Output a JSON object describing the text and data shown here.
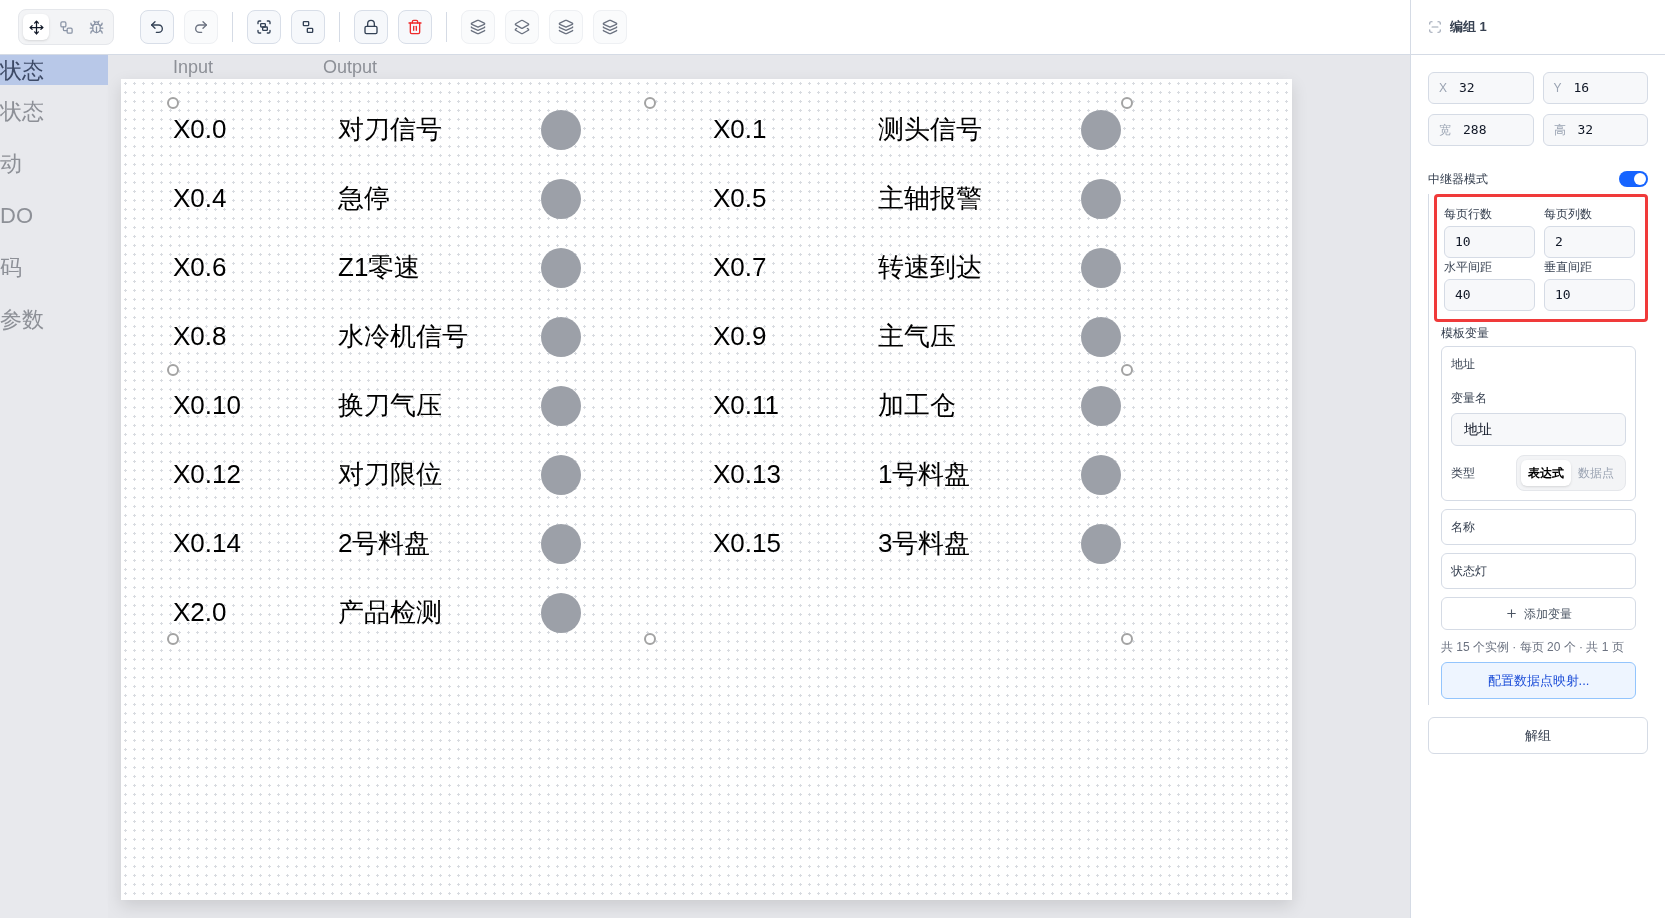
{
  "toolbar": {
    "tool_modes": [
      {
        "selected": true
      },
      {
        "selected": false
      },
      {
        "selected": false
      }
    ]
  },
  "sidebar": {
    "items": [
      {
        "label": "状态",
        "selected": true
      },
      {
        "label": "状态",
        "selected": false
      },
      {
        "label": "动",
        "selected": false
      },
      {
        "label": "DO",
        "selected": false
      },
      {
        "label": "码",
        "selected": false
      },
      {
        "label": "参数",
        "selected": false
      }
    ]
  },
  "canvas": {
    "headers": [
      "Input",
      "Output"
    ],
    "items": [
      {
        "address": "X0.0",
        "name": "对刀信号",
        "on": false
      },
      {
        "address": "X0.1",
        "name": "测头信号",
        "on": false
      },
      {
        "address": "X0.4",
        "name": "急停",
        "on": false
      },
      {
        "address": "X0.5",
        "name": "主轴报警",
        "on": false
      },
      {
        "address": "X0.6",
        "name": "Z1零速",
        "on": false
      },
      {
        "address": "X0.7",
        "name": "转速到达",
        "on": false
      },
      {
        "address": "X0.8",
        "name": "水冷机信号",
        "on": false
      },
      {
        "address": "X0.9",
        "name": "主气压",
        "on": false
      },
      {
        "address": "X0.10",
        "name": "换刀气压",
        "on": false
      },
      {
        "address": "X0.11",
        "name": "加工仓",
        "on": false
      },
      {
        "address": "X0.12",
        "name": "对刀限位",
        "on": false
      },
      {
        "address": "X0.13",
        "name": "1号料盘",
        "on": false
      },
      {
        "address": "X0.14",
        "name": "2号料盘",
        "on": false
      },
      {
        "address": "X0.15",
        "name": "3号料盘",
        "on": false
      },
      {
        "address": "X2.0",
        "name": "产品检测",
        "on": false
      }
    ]
  },
  "panel": {
    "title": "编组 1",
    "geometry": [
      {
        "label": "X",
        "value": "32"
      },
      {
        "label": "Y",
        "value": "16"
      },
      {
        "label": "宽",
        "value": "288"
      },
      {
        "label": "高",
        "value": "32"
      }
    ],
    "repeater": {
      "label": "中继器模式",
      "on": true,
      "highlighted": true,
      "settings": [
        {
          "label": "每页行数",
          "value": "10"
        },
        {
          "label": "每页列数",
          "value": "2"
        },
        {
          "label": "水平间距",
          "value": "40"
        },
        {
          "label": "垂直间距",
          "value": "10"
        }
      ],
      "template_label": "模板变量",
      "variables": [
        {
          "kind": "expanded",
          "title": "地址",
          "name_label": "变量名",
          "name_value": "地址",
          "type_label": "类型",
          "type_options": [
            {
              "label": "表达式",
              "selected": true
            },
            {
              "label": "数据点",
              "selected": false
            }
          ]
        },
        {
          "kind": "collapsed",
          "title": "名称"
        },
        {
          "kind": "collapsed",
          "title": "状态灯"
        }
      ],
      "add_button": "添加变量",
      "summary": "共 15 个实例 · 每页 20 个 · 共 1 页",
      "map_button": "配置数据点映射..."
    },
    "ungroup_button": "解组"
  }
}
